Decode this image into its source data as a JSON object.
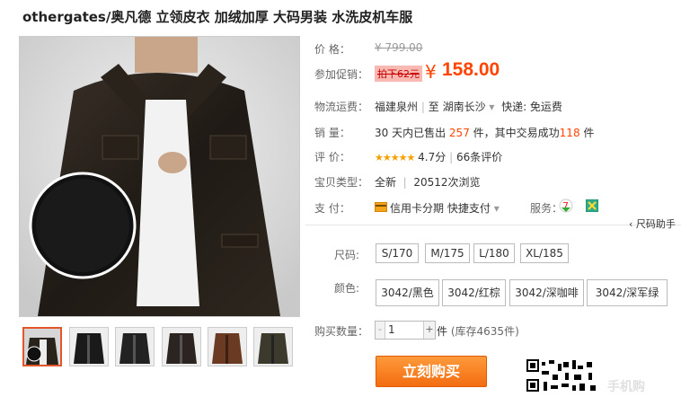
{
  "title": "othergates/奥凡德 立领皮衣 加绒加厚 大码男装 水洗皮机车服",
  "price": {
    "label": "价      格：",
    "original": "¥ 799.00"
  },
  "promo": {
    "label": "参加促销：",
    "badge": "拍下62元",
    "currency": "¥",
    "amount": "158.00"
  },
  "shipping": {
    "label": "物流运费：",
    "from": "福建泉州",
    "to_prefix": "至",
    "to": "湖南长沙",
    "dropdown": "▾",
    "express": "快递: 免运费"
  },
  "sales": {
    "label": "销      量：",
    "prefix": "30 天内已售出",
    "sold": "257",
    "mid": "件，其中交易成功",
    "success": "118",
    "suffix": "件"
  },
  "rating": {
    "label": "评      价：",
    "stars": "★★★★★",
    "score": "4.7分",
    "reviews": "66条评价"
  },
  "type": {
    "label": "宝贝类型：",
    "condition": "全新",
    "views": "20512次浏览"
  },
  "payment": {
    "label": "支      付：",
    "credit": "信用卡分期",
    "quick": "快捷支付",
    "dropdown": "▾",
    "service_label": "服务："
  },
  "size_help": "‹ 尺码助手",
  "size": {
    "label": "尺码:",
    "options": [
      "S/170",
      "M/175",
      "L/180",
      "XL/185"
    ]
  },
  "color": {
    "label": "颜色:",
    "options": [
      "3042/黑色",
      "3042/红棕",
      "3042/深咖啡",
      "3042/深军绿"
    ]
  },
  "quantity": {
    "label": "购买数量：",
    "minus": "-",
    "value": "1",
    "plus": "+",
    "unit": "件",
    "stock": "(库存4635件)"
  },
  "buy_button": "立刻购买",
  "mobile_buy": "手机购",
  "colors": {
    "accent": "#ff4400",
    "button": "#f26d10"
  }
}
